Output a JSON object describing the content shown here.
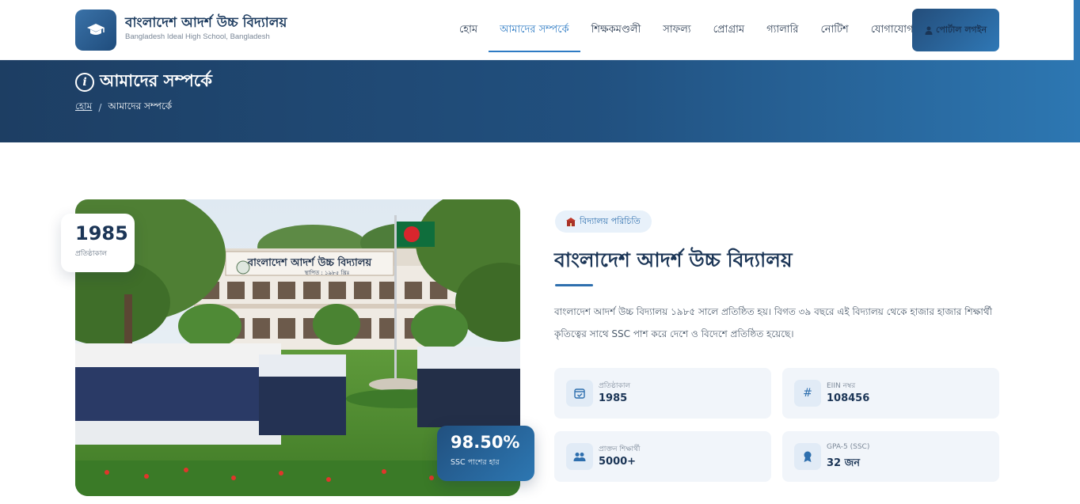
{
  "header": {
    "school_name": "বাংলাদেশ আদর্শ উচ্চ বিদ্যালয়",
    "school_name_en": "Bangladesh Ideal High School, Bangladesh",
    "logo_icon": "graduation-cap-icon",
    "nav": [
      {
        "label": "হোম",
        "active": false
      },
      {
        "label": "আমাদের সম্পর্কে",
        "active": true
      },
      {
        "label": "শিক্ষকমণ্ডলী",
        "active": false
      },
      {
        "label": "সাফল্য",
        "active": false
      },
      {
        "label": "প্রোগ্রাম",
        "active": false
      },
      {
        "label": "গ্যালারি",
        "active": false
      },
      {
        "label": "নোটিশ",
        "active": false
      },
      {
        "label": "যোগাযোগ",
        "active": false
      }
    ],
    "portal_button": "পোর্টাল লগইন",
    "portal_icon": "user-icon"
  },
  "banner": {
    "title": "আমাদের সম্পর্কে",
    "icon": "info-icon",
    "breadcrumb_home": "হোম",
    "breadcrumb_separator": "/",
    "breadcrumb_current": "আমাদের সম্পর্কে"
  },
  "photo": {
    "building_sign": "বাংলাদেশ আদর্শ উচ্চ বিদ্যালয়",
    "building_sub": "স্থাপিত : ১৯৮৫ খ্রিঃ",
    "badge_established_value": "1985",
    "badge_established_label": "প্রতিষ্ঠাকাল",
    "badge_pass_value": "98.50%",
    "badge_pass_label": "SSC পাশের হার"
  },
  "about": {
    "tag": "বিদ্যালয় পরিচিতি",
    "tag_icon": "school-icon",
    "title": "বাংলাদেশ আদর্শ উচ্চ বিদ্যালয়",
    "description": "বাংলাদেশ আদর্শ উচ্চ বিদ্যালয় ১৯৮৫ সালে প্রতিষ্ঠিত হয়। বিগত ৩৯ বছরে এই বিদ্যালয় থেকে হাজার হাজার শিক্ষার্থী কৃতিত্বের সাথে SSC পাশ করে দেশে ও বিদেশে প্রতিষ্ঠিত হয়েছে।",
    "facts": [
      {
        "label": "প্রতিষ্ঠাকাল",
        "value": "1985",
        "icon": "calendar-check-icon"
      },
      {
        "label": "EIIN নম্বর",
        "value": "108456",
        "icon": "hash-icon"
      },
      {
        "label": "প্রাক্তন শিক্ষার্থী",
        "value": "5000+",
        "icon": "users-icon"
      },
      {
        "label": "GPA-5 (SSC)",
        "value": "32 জন",
        "icon": "award-icon"
      }
    ]
  },
  "colors": {
    "primary": "#2e6fae",
    "banner_dark": "#1d3e63",
    "banner_light": "#2d77b2",
    "text_dark": "#1b3556",
    "fact_bg": "#f1f5fa"
  }
}
